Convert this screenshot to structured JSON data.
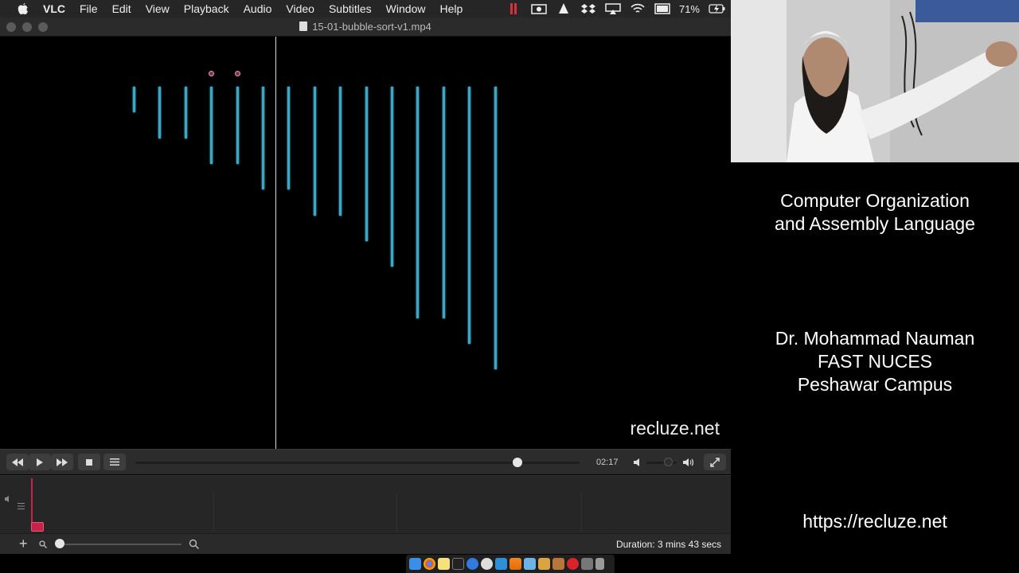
{
  "menubar": {
    "app_name": "VLC",
    "items": [
      "File",
      "Edit",
      "View",
      "Playback",
      "Audio",
      "Video",
      "Subtitles",
      "Window",
      "Help"
    ],
    "battery": "71%",
    "status_icons": [
      "recording-indicator-icon",
      "screen-record-icon",
      "vlc-cone-icon",
      "dropbox-icon",
      "airplay-icon",
      "wifi-icon",
      "display-icon",
      "battery-icon"
    ]
  },
  "window": {
    "title": "15-01-bubble-sort-v1.mp4"
  },
  "video": {
    "watermark": "recluze.net",
    "bars": [
      1,
      2,
      2,
      3,
      3,
      4,
      4,
      5,
      5,
      6,
      7,
      9,
      9,
      10,
      11
    ],
    "markers": [
      3,
      4
    ],
    "colors": {
      "bar": "#3aa6c8",
      "marker": "#e39abb"
    }
  },
  "controls": {
    "time": "02:17",
    "progress": 0.86
  },
  "statusbar": {
    "duration": "Duration: 3 mins 43 secs"
  },
  "right_panel": {
    "course_line1": "Computer Organization",
    "course_line2": "and Assembly Language",
    "author_line1": "Dr. Mohammad Nauman",
    "author_line2": "FAST NUCES",
    "author_line3": "Peshawar Campus",
    "url": "https://recluze.net"
  },
  "dock": {
    "icons": [
      "finder-icon",
      "chrome-icon",
      "notes-icon",
      "terminal-icon",
      "safari-icon",
      "compass-icon",
      "vscode-icon",
      "vlc-icon",
      "preview-icon",
      "photos-icon",
      "app-icon",
      "opera-icon",
      "app-icon-2",
      "trash-icon"
    ]
  }
}
